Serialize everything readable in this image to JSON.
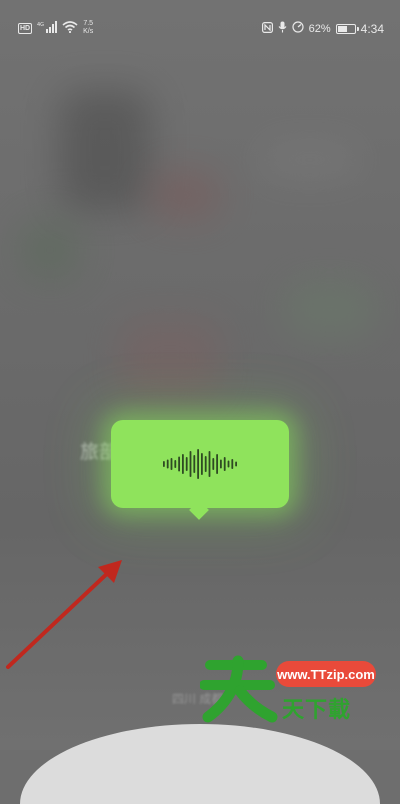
{
  "status_bar": {
    "hd_badge": "HD",
    "network_type": "4G",
    "net_speed_value": "7.5",
    "net_speed_unit": "K/s",
    "battery_percent": "62%",
    "battery_level": 0.62,
    "time": "4:34"
  },
  "background": {
    "blurred_text": "旅部",
    "blurred_bottom_text": "四川 成都"
  },
  "voice_bubble": {
    "color": "#8fe35c",
    "waveform_bars": [
      6,
      9,
      12,
      8,
      15,
      20,
      14,
      26,
      18,
      30,
      22,
      16,
      26,
      12,
      20,
      9,
      14,
      7,
      10,
      5
    ]
  },
  "annotation": {
    "arrow_color": "#c0281e"
  },
  "watermark": {
    "tian_color": "#2fa32f",
    "url": "www.TTzip.com",
    "brand": "天下載"
  }
}
